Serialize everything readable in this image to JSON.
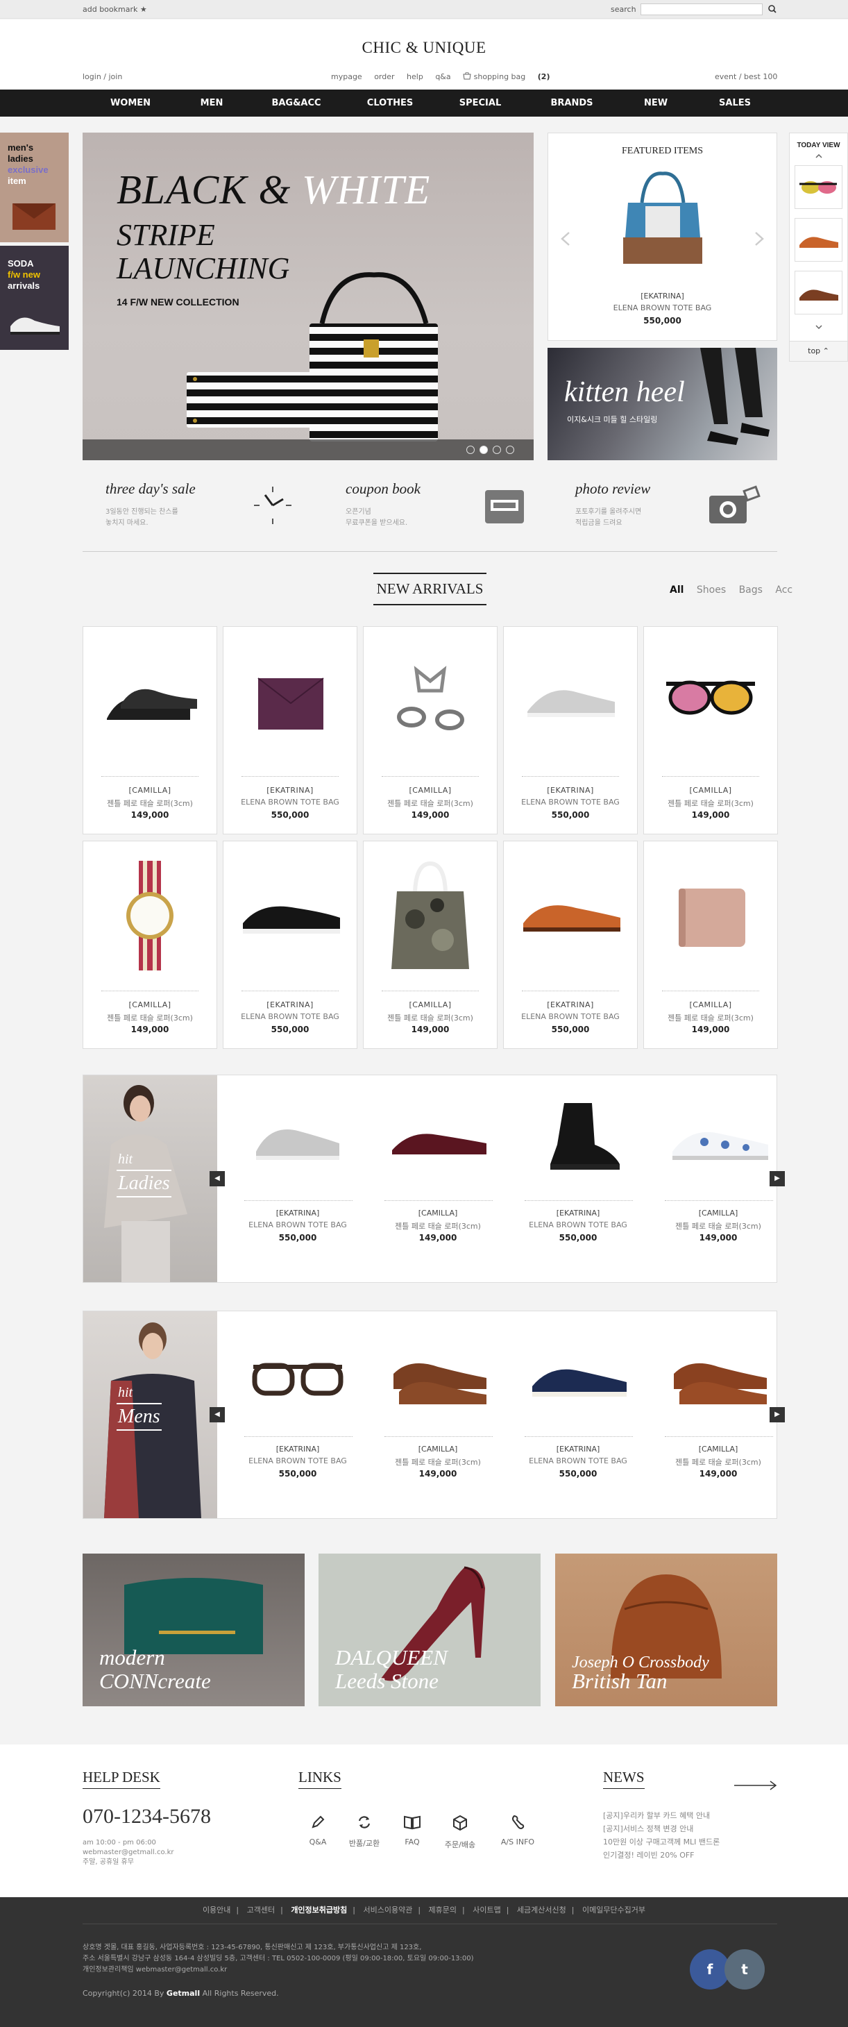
{
  "top": {
    "bookmark": "add bookmark ★",
    "search_label": "search",
    "search_placeholder": ""
  },
  "header": {
    "logo": "CHIC & UNIQUE",
    "login": "login  /  join",
    "links": [
      "mypage",
      "order",
      "help",
      "q&a"
    ],
    "shopping_bag": "shopping bag",
    "bag_count": "(2)",
    "event": "event  /  best 100"
  },
  "nav": [
    "WOMEN",
    "MEN",
    "BAG&ACC",
    "CLOTHES",
    "SPECIAL",
    "BRANDS",
    "NEW",
    "SALES"
  ],
  "side": {
    "promo1": [
      "men's",
      "ladies",
      "exclusive",
      "item"
    ],
    "promo2": [
      "SODA",
      "f/w new",
      "arrivals"
    ]
  },
  "today_view": {
    "title": "TODAY VIEW",
    "top": "top"
  },
  "banner": {
    "line1_black": "BLACK & ",
    "line1_white": "WHITE",
    "line2": "STRIPE",
    "line3": "LAUNCHING",
    "sub": "14 F/W NEW COLLECTION",
    "slides": 4,
    "active_slide": 2
  },
  "featured": {
    "title": "FEATURED ITEMS",
    "brand": "[EKATRINA]",
    "name": "ELENA BROWN TOTE BAG",
    "price": "550,000"
  },
  "kitten": {
    "title": "kitten heel",
    "sub": "이지&시크 미들 힐 스타일링"
  },
  "info": [
    {
      "title": "three day's sale",
      "line1": "3일동안 진행되는 찬스를",
      "line2": "놓치지 마세요.",
      "icon": "clock-icon"
    },
    {
      "title": "coupon book",
      "line1": "오픈기념",
      "line2": "무료쿠폰을 받으세요.",
      "icon": "coupon-icon"
    },
    {
      "title": "photo review",
      "line1": "포토후기를 올려주시면",
      "line2": "적립금을 드려요",
      "icon": "camera-icon"
    }
  ],
  "new_arrivals": {
    "title": "NEW ARRIVALS",
    "filters": [
      "All",
      "Shoes",
      "Bags",
      "Acc"
    ],
    "products": [
      {
        "brand": "[CAMILLA]",
        "name": "젠틀 페로 태슬 로퍼(3cm)",
        "price": "149,000",
        "icon": "loafer-icon"
      },
      {
        "brand": "[EKATRINA]",
        "name": "ELENA BROWN TOTE BAG",
        "price": "550,000",
        "icon": "clutch-icon"
      },
      {
        "brand": "[CAMILLA]",
        "name": "젠틀 페로 태슬 로퍼(3cm)",
        "price": "149,000",
        "icon": "rings-icon"
      },
      {
        "brand": "[EKATRINA]",
        "name": "ELENA BROWN TOTE BAG",
        "price": "550,000",
        "icon": "sneaker-icon"
      },
      {
        "brand": "[CAMILLA]",
        "name": "젠틀 페로 태슬 로퍼(3cm)",
        "price": "149,000",
        "icon": "sunglasses-icon"
      },
      {
        "brand": "[CAMILLA]",
        "name": "젠틀 페로 태슬 로퍼(3cm)",
        "price": "149,000",
        "icon": "watch-icon"
      },
      {
        "brand": "[EKATRINA]",
        "name": "ELENA BROWN TOTE BAG",
        "price": "550,000",
        "icon": "slipon-icon"
      },
      {
        "brand": "[CAMILLA]",
        "name": "젠틀 페로 태슬 로퍼(3cm)",
        "price": "149,000",
        "icon": "tote-icon"
      },
      {
        "brand": "[EKATRINA]",
        "name": "ELENA BROWN TOTE BAG",
        "price": "550,000",
        "icon": "tassel-loafer-icon"
      },
      {
        "brand": "[CAMILLA]",
        "name": "젠틀 페로 태슬 로퍼(3cm)",
        "price": "149,000",
        "icon": "wallet-icon"
      }
    ]
  },
  "hit_ladies": {
    "label1": "hit",
    "label2": "Ladies",
    "items": [
      {
        "brand": "[EKATRINA]",
        "name": "ELENA BROWN TOTE BAG",
        "price": "550,000"
      },
      {
        "brand": "[CAMILLA]",
        "name": "젠틀 페로 태슬 로퍼(3cm)",
        "price": "149,000"
      },
      {
        "brand": "[EKATRINA]",
        "name": "ELENA BROWN TOTE BAG",
        "price": "550,000"
      },
      {
        "brand": "[CAMILLA]",
        "name": "젠틀 페로 태슬 로퍼(3cm)",
        "price": "149,000"
      }
    ]
  },
  "hit_mens": {
    "label1": "hit",
    "label2": "Mens",
    "items": [
      {
        "brand": "[EKATRINA]",
        "name": "ELENA BROWN TOTE BAG",
        "price": "550,000"
      },
      {
        "brand": "[CAMILLA]",
        "name": "젠틀 페로 태슬 로퍼(3cm)",
        "price": "149,000"
      },
      {
        "brand": "[EKATRINA]",
        "name": "ELENA BROWN TOTE BAG",
        "price": "550,000"
      },
      {
        "brand": "[CAMILLA]",
        "name": "젠틀 페로 태슬 로퍼(3cm)",
        "price": "149,000"
      }
    ]
  },
  "bottom_banners": [
    {
      "line1": "modern",
      "line2": "CONNcreate"
    },
    {
      "line1": "DALQUEEN",
      "line2": "Leeds Stone"
    },
    {
      "line1": "Joseph O Crossbody",
      "line2": "British Tan"
    }
  ],
  "help_desk": {
    "title": "HELP DESK",
    "phone": "070-1234-5678",
    "hours": "am 10:00 - pm 06:00",
    "email": "webmaster@getmall.co.kr",
    "closed": "주말, 공휴일 휴무"
  },
  "links": {
    "title": "LINKS",
    "items": [
      "Q&A",
      "반품/교환",
      "FAQ",
      "주문/배송",
      "A/S INFO"
    ]
  },
  "news": {
    "title": "NEWS",
    "items": [
      "[공지]우리카 할부 카드 혜택 안내",
      "[공지]서비스 정책 변경 안내",
      "10만원 이상 구매고객께 MLI 밴드론",
      "인기결정! 레이빈 20% OFF"
    ]
  },
  "footer": {
    "links": [
      "이용안내",
      "고객센터",
      "개인정보취급방침",
      "서비스이용약관",
      "제휴문의",
      "사이트맵",
      "세금계산서신청",
      "이메일무단수집거부"
    ],
    "bold_index": 2,
    "addr1": "상호명 겟몰,  대표 홍길동,   사업자등록번호 : 123-45-67890,   통신판매신고 제 123호,     부가통신사업신고 제 123호,",
    "addr2": "주소  서울특별시 강남구 삼성동 164-4 삼성빌딩 5층,  고객센터 : TEL 0502-100-0009 (평일 09:00-18:00, 토요일 09:00-13:00)",
    "addr3": "개인정보관리책임  webmaster@getmall.co.kr",
    "copyright_pre": "Copyright(c) 2014 By ",
    "copyright_brand": "Getmall",
    "copyright_post": " All Rights Reserved."
  },
  "colors": {
    "nav_bg": "#1c1c1c",
    "accent_purple": "#7a6fc8",
    "accent_yellow": "#f0c200",
    "footer_bg": "#333333"
  }
}
